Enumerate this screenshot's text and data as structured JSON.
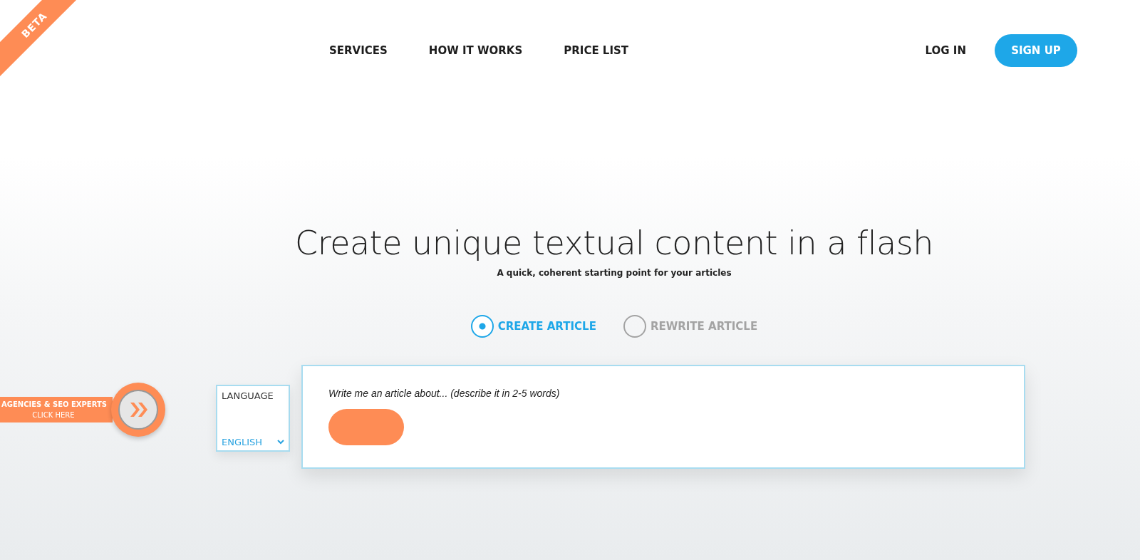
{
  "ribbon": {
    "label": "BETA"
  },
  "nav": {
    "links": [
      {
        "label": "SERVICES"
      },
      {
        "label": "HOW IT WORKS"
      },
      {
        "label": "PRICE LIST"
      }
    ],
    "login": "LOG IN",
    "signup": "SIGN UP"
  },
  "hero": {
    "title": "Create unique textual content in a flash",
    "subtitle": "A quick, coherent starting point for your articles"
  },
  "modes": [
    {
      "label": "CREATE ARTICLE",
      "selected": true
    },
    {
      "label": "REWRITE ARTICLE",
      "selected": false
    }
  ],
  "language": {
    "label": "LANGUAGE",
    "value": "ENGLISH"
  },
  "prompt": {
    "placeholder": "Write me an article about... (describe it in 2-5 words)"
  },
  "agency_tab": {
    "line_1": "AGENCIES & SEO EXPERTS",
    "line_2": "CLICK HERE"
  }
}
